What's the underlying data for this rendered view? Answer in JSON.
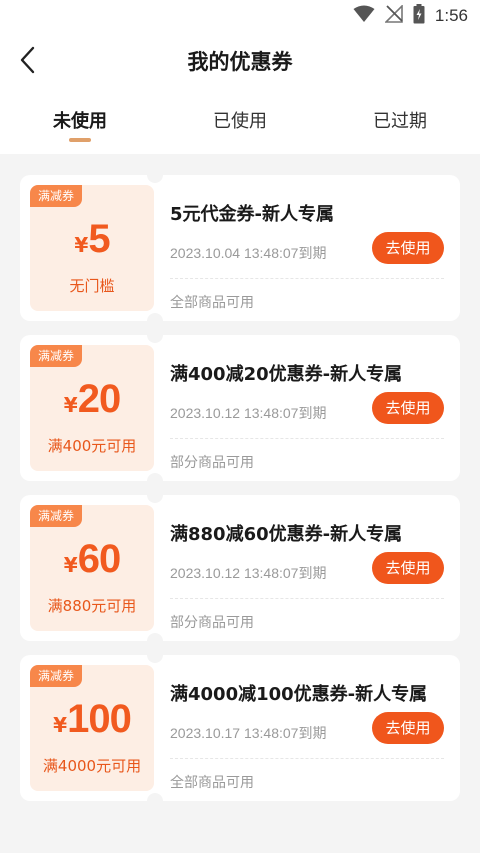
{
  "status_bar": {
    "time": "1:56"
  },
  "nav": {
    "title": "我的优惠券"
  },
  "tabs": [
    {
      "label": "未使用",
      "active": true
    },
    {
      "label": "已使用",
      "active": false
    },
    {
      "label": "已过期",
      "active": false
    }
  ],
  "coupons": [
    {
      "tag": "满减券",
      "currency": "¥",
      "amount": "5",
      "condition": "无门槛",
      "title": "5元代金券-新人专属",
      "expire": "2023.10.04 13:48:07到期",
      "button": "去使用",
      "scope": "全部商品可用"
    },
    {
      "tag": "满减券",
      "currency": "¥",
      "amount": "20",
      "condition": "满400元可用",
      "title": "满400减20优惠券-新人专属",
      "expire": "2023.10.12 13:48:07到期",
      "button": "去使用",
      "scope": "部分商品可用"
    },
    {
      "tag": "满减券",
      "currency": "¥",
      "amount": "60",
      "condition": "满880元可用",
      "title": "满880减60优惠券-新人专属",
      "expire": "2023.10.12 13:48:07到期",
      "button": "去使用",
      "scope": "部分商品可用"
    },
    {
      "tag": "满减券",
      "currency": "¥",
      "amount": "100",
      "condition": "满4000元可用",
      "title": "满4000减100优惠券-新人专属",
      "expire": "2023.10.17 13:48:07到期",
      "button": "去使用",
      "scope": "全部商品可用"
    }
  ],
  "colors": {
    "accent": "#f0561c",
    "tag": "#f7874a",
    "coupon_bg": "#fdeee4",
    "tab_indicator": "#e0a06a"
  },
  "icons": {
    "status": [
      "wifi-icon",
      "no-signal-icon",
      "battery-charging-icon"
    ],
    "back": "chevron-left-icon"
  }
}
